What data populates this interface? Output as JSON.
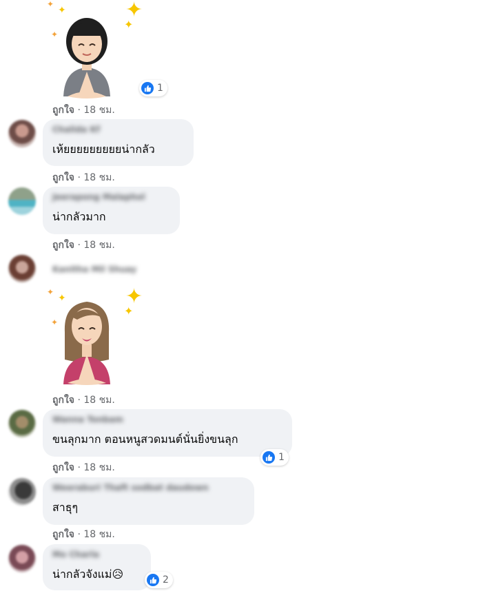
{
  "reaction_colors": {
    "like": "#1877f2"
  },
  "icons": {
    "like": "like-thumbs-up-icon",
    "sticker": "namaste-avatar-sticker"
  },
  "comments": [
    {
      "author": "",
      "sticker": "avatar-namaste-short-hair",
      "reaction_count": "1",
      "like_label": "ถูกใจ",
      "separator": "·",
      "time": "18 ชม."
    },
    {
      "author": "Chalida Kf",
      "text": "เห้ยยยยยยยยยน่ากลัว",
      "like_label": "ถูกใจ",
      "separator": "·",
      "time": "18 ชม."
    },
    {
      "author": "Jeerapong Malaphol",
      "text": "น่ากลัวมาก",
      "like_label": "ถูกใจ",
      "separator": "·",
      "time": "18 ชม."
    },
    {
      "author": "Kanitha Mil Shuay",
      "sticker": "avatar-namaste-long-hair",
      "like_label": "ถูกใจ",
      "separator": "·",
      "time": "18 ชม."
    },
    {
      "author": "Wanna Tonbam",
      "text": "ขนลุกมาก ตอนหนูสวดมนต์นั่นยิ่งขนลุก",
      "reaction_count": "1",
      "like_label": "ถูกใจ",
      "separator": "·",
      "time": "18 ชม."
    },
    {
      "author": "Weeraburi Thaft sodbat daudown",
      "text": "สาธุๆ",
      "like_label": "ถูกใจ",
      "separator": "·",
      "time": "18 ชม."
    },
    {
      "author": "Mo Charla",
      "text": "น่ากลัวจังแม่",
      "emoji": "😥",
      "reaction_count": "2"
    }
  ]
}
